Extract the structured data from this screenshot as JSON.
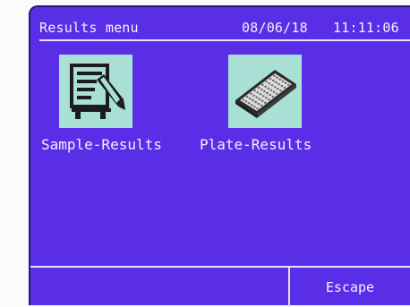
{
  "header": {
    "title": "Results menu",
    "date": "08/06/18",
    "time": "11:11:06"
  },
  "menu": {
    "items": [
      {
        "label": "Sample-Results",
        "icon": "document-pencil-icon"
      },
      {
        "label": "Plate-Results",
        "icon": "microplate-icon"
      }
    ]
  },
  "footer": {
    "escape_label": "Escape"
  },
  "colors": {
    "screen_background": "#5a2ee6",
    "tile_background": "#a8e0d6",
    "text": "#f4f0ff"
  }
}
